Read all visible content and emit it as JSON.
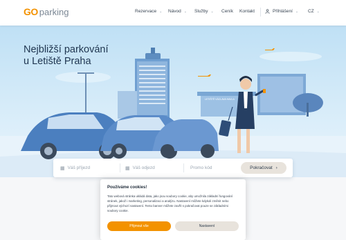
{
  "brand": {
    "logo_go": "GO",
    "logo_rest": "parking",
    "accent_color": "#f39200"
  },
  "nav": {
    "items": [
      {
        "label": "Rezervace",
        "dropdown": true
      },
      {
        "label": "Návod",
        "dropdown": true
      },
      {
        "label": "Služby",
        "dropdown": true
      },
      {
        "label": "Ceník",
        "dropdown": false
      },
      {
        "label": "Kontakt",
        "dropdown": false
      }
    ],
    "login_label": "Přihlášení",
    "language": "CZ"
  },
  "hero": {
    "title_line1": "Nejbližší parkování",
    "title_line2": "u Letiště Praha",
    "terminal_sign": "LETIŠTĚ VÁCLAVA HAVLA"
  },
  "search": {
    "arrival_placeholder": "Váš příjezd",
    "departure_placeholder": "Váš odjezd",
    "promo_placeholder": "Promo kód",
    "continue_label": "Pokračovat"
  },
  "cookie": {
    "title": "Používáme cookies!",
    "text": "Tato webová stránka ukládá data, jako jsou soubory cookie, aby umožnila základní fungování stránek, jakož i marketing, personalizaci a analýzu. Nastavení můžete kdykoli změnit nebo přijmout výchozí nastavení. Tento banner můžete zavřít s pokračovat pouze se základními soubory cookie.",
    "accept_label": "Přijmout vše",
    "settings_label": "Nastavení"
  },
  "icons": {
    "user": "user-icon",
    "calendar": "calendar-icon",
    "chevron": "chevron-down-icon",
    "arrow": "chevron-right-icon"
  }
}
